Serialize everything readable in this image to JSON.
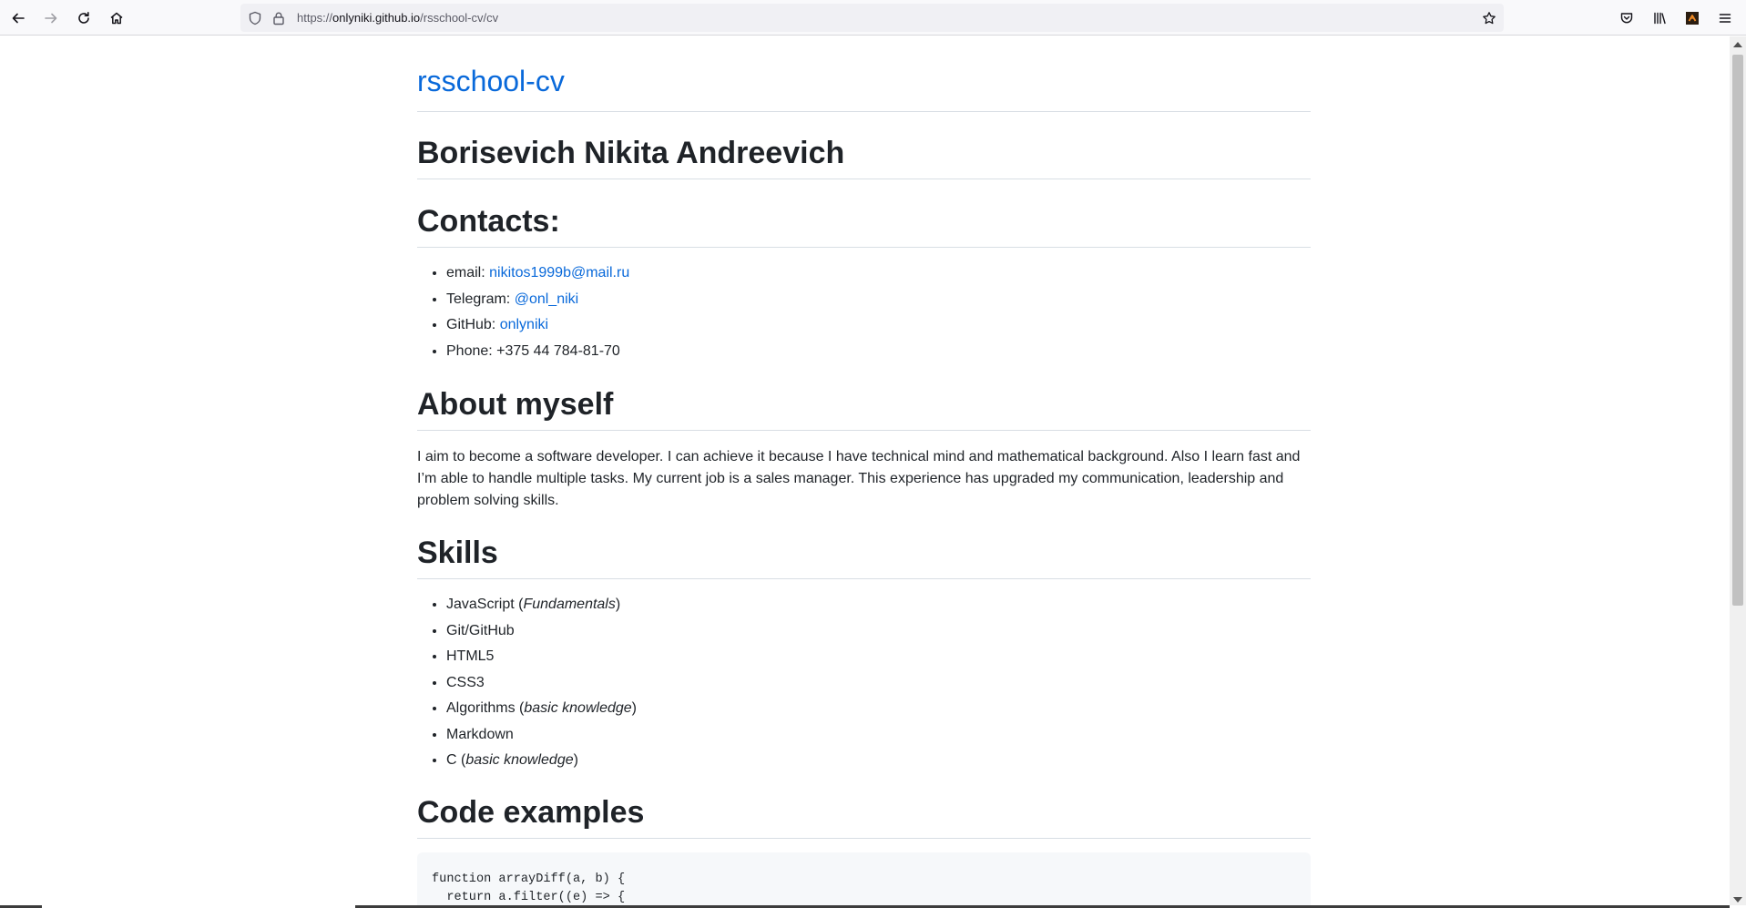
{
  "browser": {
    "url_scheme": "https://",
    "url_host": "onlyniki.github.io",
    "url_path": "/rsschool-cv/cv",
    "icons": {
      "back": "arrow-left-icon",
      "forward": "arrow-right-icon",
      "reload": "reload-icon",
      "home": "home-icon",
      "tracking": "shield-icon",
      "lock": "lock-icon",
      "bookmark": "star-icon",
      "pocket": "pocket-icon",
      "library": "library-icon",
      "extension": "extension-icon",
      "menu": "hamburger-menu-icon"
    }
  },
  "page": {
    "site_title": "rsschool-cv",
    "name_heading": "Borisevich Nikita Andreevich",
    "contacts": {
      "heading": "Contacts:",
      "items": [
        {
          "label": "email: ",
          "value": "nikitos1999b@mail.ru"
        },
        {
          "label": "Telegram: ",
          "value": "@onl_niki"
        },
        {
          "label": "GitHub: ",
          "value": "onlyniki"
        },
        {
          "label": "Phone: +375 44 784-81-70"
        }
      ]
    },
    "about": {
      "heading": "About myself",
      "text": "I aim to become a software developer. I can achieve it because I have technical mind and mathematical background. Also I learn fast and I’m able to handle multiple tasks. My current job is a sales manager. This experience has upgraded my communication, leadership and problem solving skills."
    },
    "skills": {
      "heading": "Skills",
      "items": [
        {
          "text": "JavaScript (",
          "em": "Fundamentals",
          "after": ")"
        },
        {
          "text": "Git/GitHub"
        },
        {
          "text": "HTML5"
        },
        {
          "text": "CSS3"
        },
        {
          "text": "Algorithms (",
          "em": "basic knowledge",
          "after": ")"
        },
        {
          "text": "Markdown"
        },
        {
          "text": "C (",
          "em": "basic knowledge",
          "after": ")"
        }
      ]
    },
    "code": {
      "heading": "Code examples",
      "line1": "function arrayDiff(a, b) {",
      "line2": "  return a.filter((e) => {"
    }
  },
  "colors": {
    "link": "#0969da",
    "text": "#1f2328",
    "border": "#d8dee4",
    "code_bg": "#f6f8fa"
  }
}
